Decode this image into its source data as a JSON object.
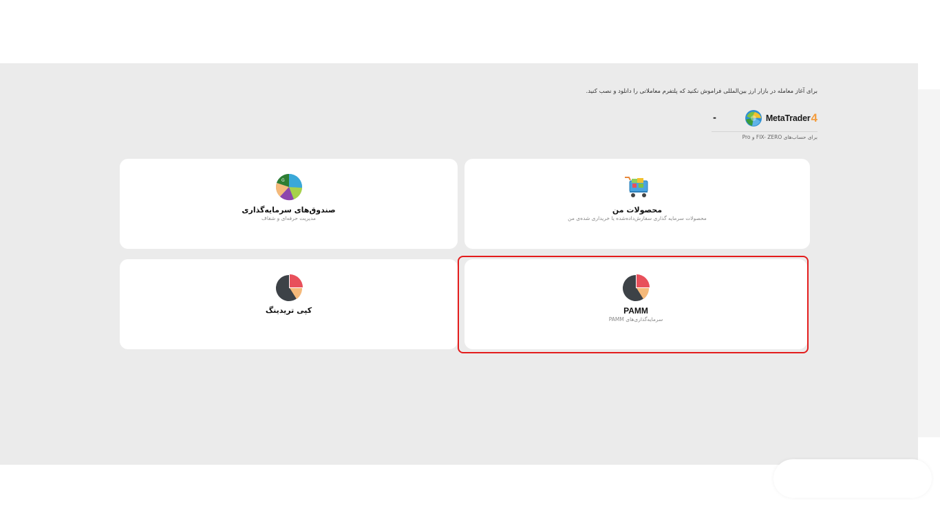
{
  "intro": {
    "text": "برای آغاز معامله در بازار ارز بین‌المللی فراموش نکنید که پلتفرم معاملاتی را دانلود و نصب کنید."
  },
  "platform": {
    "name": "MetaTrader",
    "version": "4",
    "dash": "-",
    "note": "برای حساب‌های FIX- ZERO و Pro",
    "accent": "#f39c3d"
  },
  "cards": [
    {
      "title": "محصولات من",
      "subtitle": "محصولات سرمایه گذاری سفارش‌داده‌شده یا خریداری شده‌ی من",
      "icon": "shopping-cart-icon"
    },
    {
      "title": "صندوق‌های سرمایه‌گذاری",
      "subtitle": "مدیریت حرفه‌ای و شفاف",
      "icon": "fund-pie-icon"
    },
    {
      "title": "PAMM",
      "subtitle": "سرمایه‌گذاری‌های PAMM",
      "icon": "pie-chart-icon"
    },
    {
      "title": "کپی تریدینگ",
      "subtitle": "",
      "icon": "pie-chart-icon"
    }
  ],
  "colors": {
    "background": "#ebebeb",
    "card": "#ffffff",
    "highlight": "#e31b1b",
    "pie_dark": "#3d4247",
    "pie_red": "#e8505b",
    "pie_peach": "#f5b97a"
  }
}
